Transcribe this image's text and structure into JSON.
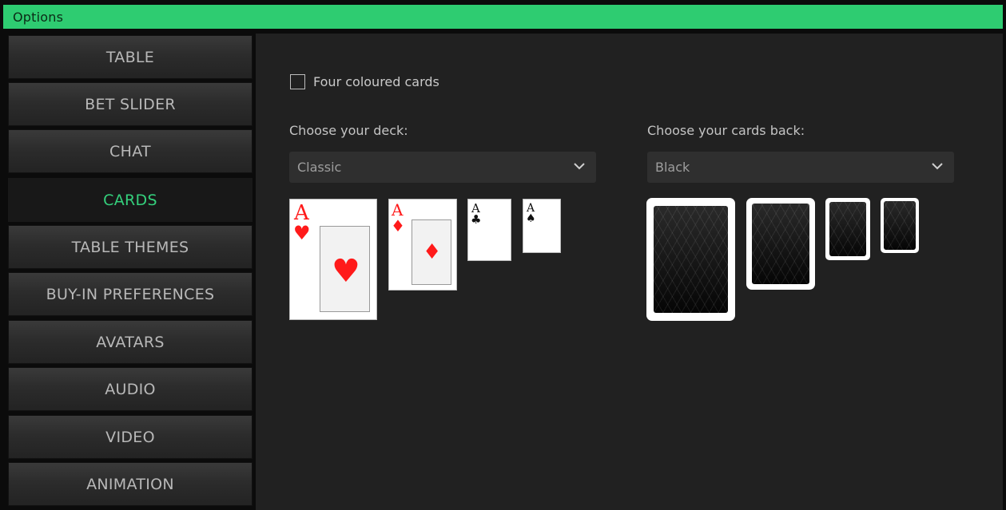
{
  "window": {
    "title": "Options"
  },
  "sidebar": {
    "items": [
      {
        "label": "TABLE",
        "active": false
      },
      {
        "label": "BET SLIDER",
        "active": false
      },
      {
        "label": "CHAT",
        "active": false
      },
      {
        "label": "CARDS",
        "active": true
      },
      {
        "label": "TABLE THEMES",
        "active": false
      },
      {
        "label": "BUY-IN PREFERENCES",
        "active": false
      },
      {
        "label": "AVATARS",
        "active": false
      },
      {
        "label": "AUDIO",
        "active": false
      },
      {
        "label": "VIDEO",
        "active": false
      },
      {
        "label": "ANIMATION",
        "active": false
      }
    ]
  },
  "cards_panel": {
    "four_coloured": {
      "label": "Four coloured cards",
      "checked": false
    },
    "deck": {
      "label": "Choose your deck:",
      "selected": "Classic"
    },
    "back": {
      "label": "Choose your cards back:",
      "selected": "Black"
    },
    "deck_previews": [
      {
        "rank": "A",
        "suit": "♥",
        "color": "red"
      },
      {
        "rank": "A",
        "suit": "♦",
        "color": "red"
      },
      {
        "rank": "A",
        "suit": "♣",
        "color": "black"
      },
      {
        "rank": "A",
        "suit": "♠",
        "color": "black"
      }
    ]
  },
  "colors": {
    "accent": "#2ecc71",
    "active_text": "#34d07c",
    "panel": "#212121"
  }
}
